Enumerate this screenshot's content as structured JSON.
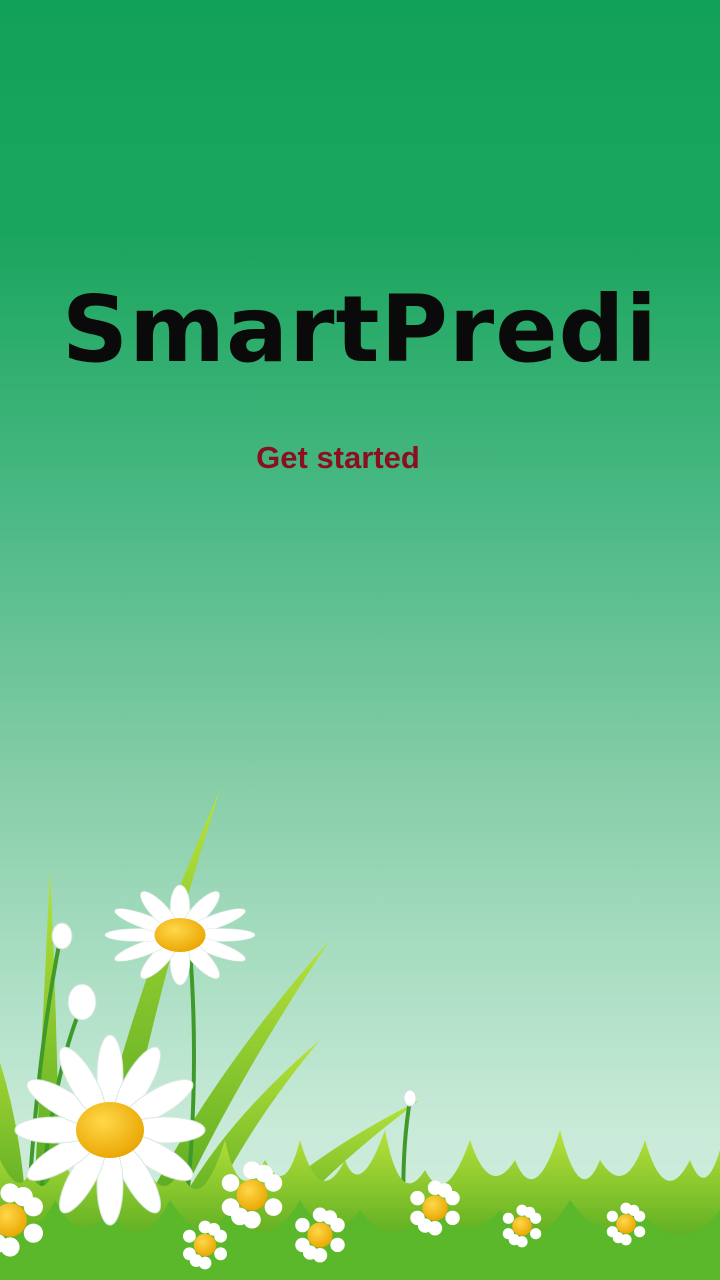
{
  "app": {
    "title": "SmartPredi"
  },
  "actions": {
    "get_started_label": "Get started"
  },
  "colors": {
    "background_top": "#12a158",
    "background_bottom": "#d6efe2",
    "button_text": "#8a1020",
    "title_text": "#0a0a0a"
  },
  "illustration": {
    "icons": [
      "daisy-flower-icon",
      "grass-blade-icon",
      "flower-bud-icon"
    ]
  }
}
